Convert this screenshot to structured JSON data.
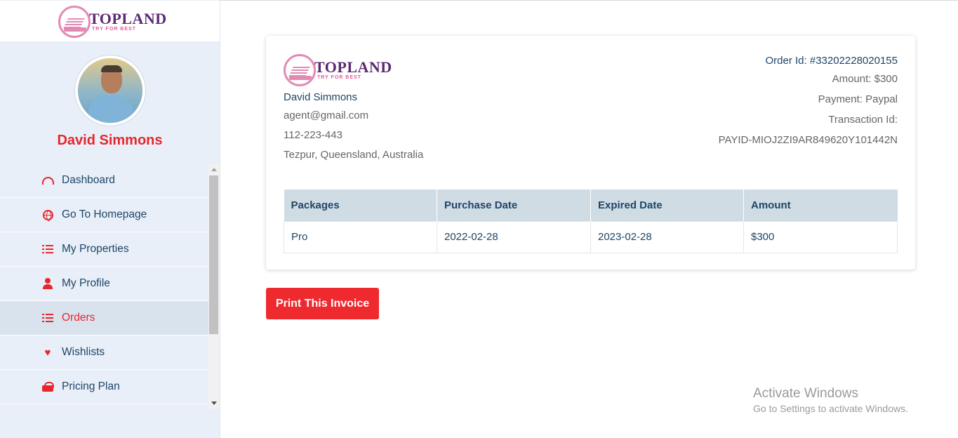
{
  "brand": {
    "name": "TOPLAND",
    "tagline": "TRY FOR BEST"
  },
  "sidebar": {
    "user_name": "David Simmons",
    "menu": [
      {
        "label": "Dashboard",
        "icon": "dashboard-icon",
        "active": false
      },
      {
        "label": "Go To Homepage",
        "icon": "globe-icon",
        "active": false
      },
      {
        "label": "My Properties",
        "icon": "list-icon",
        "active": false
      },
      {
        "label": "My Profile",
        "icon": "user-icon",
        "active": false
      },
      {
        "label": "Orders",
        "icon": "list-icon",
        "active": true
      },
      {
        "label": "Wishlists",
        "icon": "heart-icon",
        "active": false
      },
      {
        "label": "Pricing Plan",
        "icon": "gift-icon",
        "active": false
      }
    ]
  },
  "invoice": {
    "customer": {
      "name": "David Simmons",
      "email": "agent@gmail.com",
      "phone": "112-223-443",
      "address": "Tezpur, Queensland, Australia"
    },
    "order_id": "Order Id: #33202228020155",
    "amount": "Amount: $300",
    "payment": "Payment: Paypal",
    "transaction_label": "Transaction Id:",
    "transaction_id": "PAYID-MIOJ2ZI9AR849620Y101442N",
    "table": {
      "headers": [
        "Packages",
        "Purchase Date",
        "Expired Date",
        "Amount"
      ],
      "rows": [
        [
          "Pro",
          "2022-02-28",
          "2023-02-28",
          "$300"
        ]
      ]
    },
    "print_label": "Print This Invoice"
  },
  "watermark": {
    "title": "Activate Windows",
    "subtitle": "Go to Settings to activate Windows."
  },
  "colors": {
    "accent": "#ee2a2f",
    "navy": "#1f4566",
    "brand_purple": "#5b2a73",
    "brand_pink": "#e38ab4",
    "sidebar_bg": "#e8eff8",
    "table_header_bg": "#cfdce4"
  }
}
